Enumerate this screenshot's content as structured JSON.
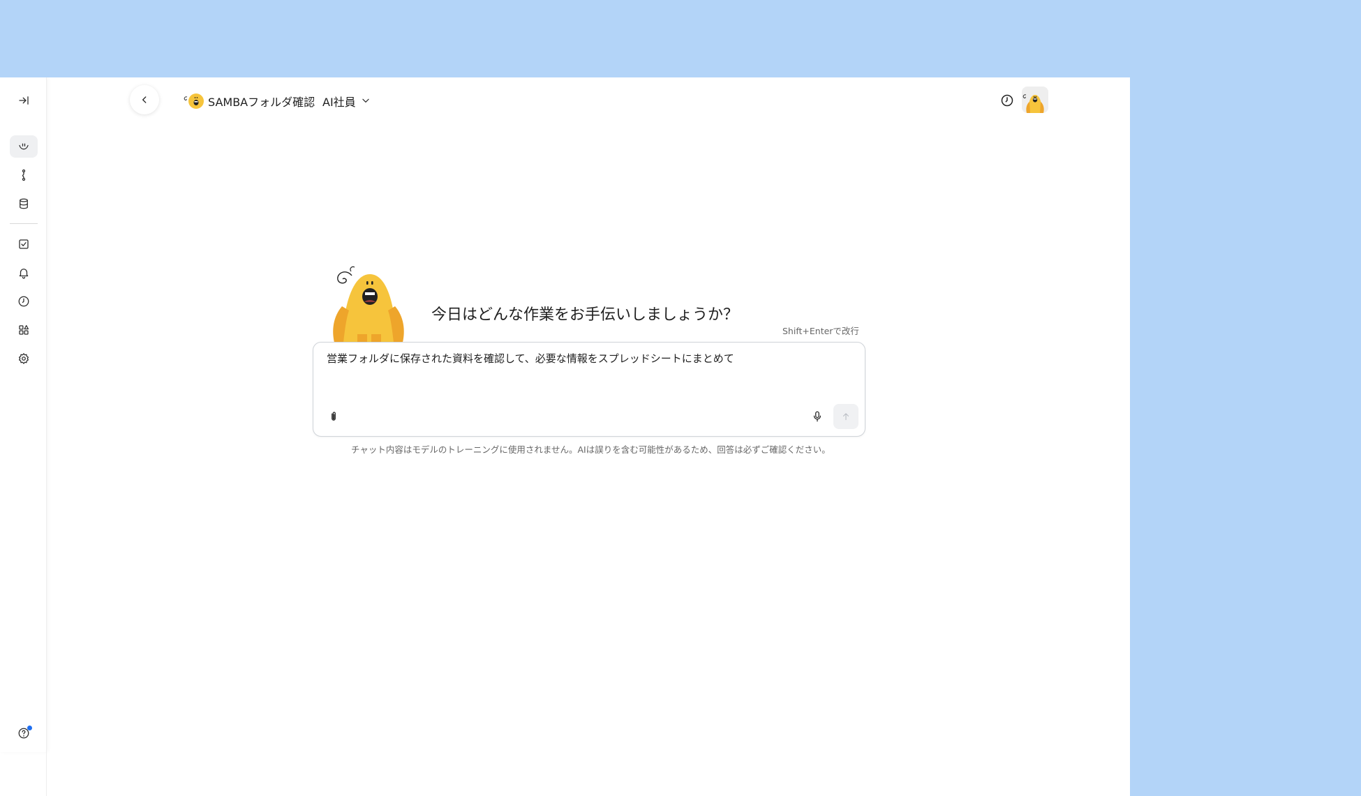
{
  "colors": {
    "desktop_background": "#b3d4f8",
    "window_background": "#ffffff",
    "mascot_yellow": "#f6c43c",
    "mascot_orange": "#eea52b",
    "help_badge": "#1e6ef0"
  },
  "sidebar": {
    "items": [
      {
        "name": "expand-sidebar",
        "icon": "panel-expand-icon"
      },
      {
        "name": "chat",
        "icon": "smile-chat-icon",
        "active": true
      },
      {
        "name": "workflow",
        "icon": "workflow-icon"
      },
      {
        "name": "database",
        "icon": "database-icon"
      },
      {
        "name": "tasks",
        "icon": "checkbox-icon"
      },
      {
        "name": "notifications",
        "icon": "bell-icon"
      },
      {
        "name": "history",
        "icon": "clock-icon"
      },
      {
        "name": "apps",
        "icon": "apps-icon"
      },
      {
        "name": "settings",
        "icon": "gear-icon"
      },
      {
        "name": "help",
        "icon": "help-circle-icon",
        "badge": true
      }
    ]
  },
  "header": {
    "agent_title": "SAMBAフォルダ確認",
    "role_label": "AI社員",
    "back_icon": "chevron-left-icon",
    "role_icon": "chevron-down-icon",
    "history_icon": "clock-icon"
  },
  "main": {
    "greeting": "今日はどんな作業をお手伝いしましょうか？",
    "newline_hint": "Shift+Enterで改行",
    "composer_value": "営業フォルダに保存された資料を確認して、必要な情報をスプレッドシートにまとめて",
    "attach_icon": "paperclip-icon",
    "mic_icon": "microphone-icon",
    "send_icon": "arrow-up-icon",
    "disclaimer": "チャット内容はモデルのトレーニングに使用されません。AIは誤りを含む可能性があるため、回答は必ずご確認ください。"
  }
}
